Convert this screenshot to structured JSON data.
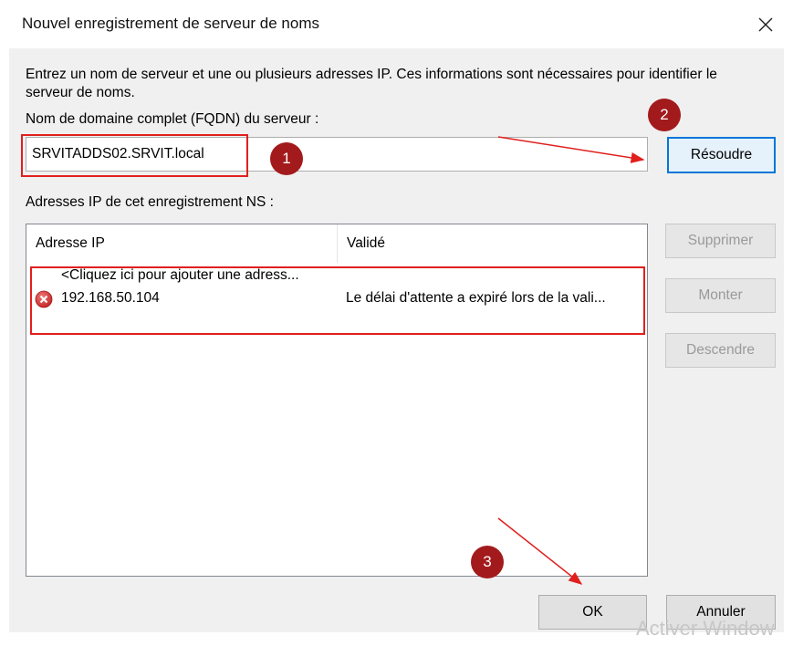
{
  "dialog": {
    "title": "Nouvel enregistrement de serveur de noms",
    "description": "Entrez un nom de serveur et une ou plusieurs adresses IP. Ces informations sont nécessaires pour identifier le serveur de noms.",
    "fqdn_label": "Nom de domaine complet (FQDN) du serveur :",
    "fqdn_value": "SRVITADDS02.SRVIT.local",
    "resolve_label": "Résoudre",
    "ip_section_label": "Adresses IP de cet enregistrement NS :",
    "columns": [
      "Adresse IP",
      "Validé"
    ],
    "placeholder_row": "<Cliquez ici pour ajouter une adress...",
    "rows": [
      {
        "ip": "192.168.50.104",
        "status": "Le délai d'attente a expiré lors de la vali...",
        "status_icon": "error-icon"
      }
    ],
    "delete_label": "Supprimer",
    "up_label": "Monter",
    "down_label": "Descendre",
    "ok_label": "OK",
    "cancel_label": "Annuler"
  },
  "annotations": {
    "badges": [
      "1",
      "2",
      "3"
    ],
    "color": "#e0201e",
    "badge_color": "#a31a1c"
  },
  "watermark": "Activer Window",
  "colors": {
    "primary_border": "#0078d7",
    "error_red": "#d3302f"
  }
}
